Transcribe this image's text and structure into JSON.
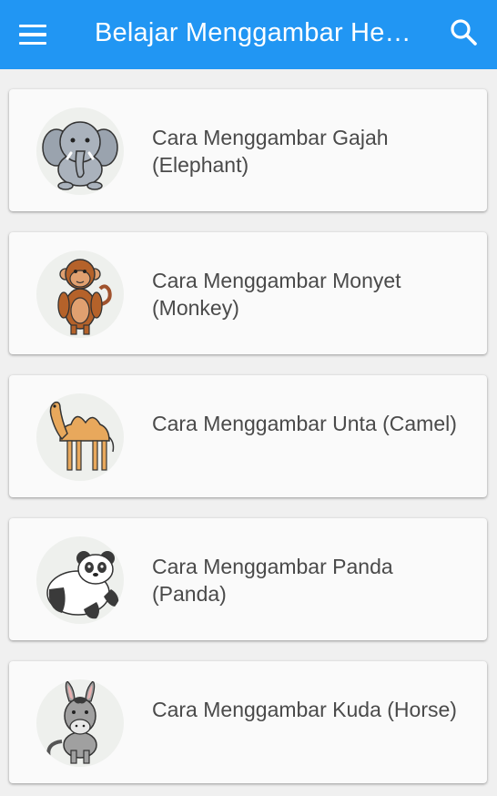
{
  "appbar": {
    "title": "Belajar Menggambar Hewan",
    "menu_icon": "hamburger-menu-icon",
    "search_icon": "search-icon",
    "color": "#2196f3"
  },
  "items": [
    {
      "label": "Cara Menggambar Gajah (Elephant)",
      "icon": "elephant-icon"
    },
    {
      "label": "Cara Menggambar Monyet (Monkey)",
      "icon": "monkey-icon"
    },
    {
      "label": "Cara Menggambar Unta (Camel)",
      "icon": "camel-icon"
    },
    {
      "label": "Cara Menggambar Panda (Panda)",
      "icon": "panda-icon"
    },
    {
      "label": "Cara Menggambar Kuda (Horse)",
      "icon": "horse-icon"
    }
  ]
}
